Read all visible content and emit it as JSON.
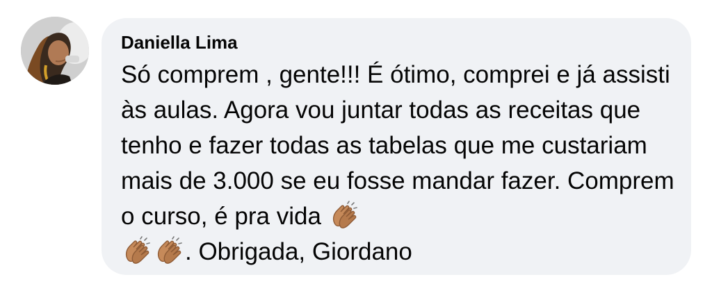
{
  "comment": {
    "author": "Daniella Lima",
    "text_part1": "Só comprem , gente!!! É ótimo, comprei e já assisti às aulas. Agora vou juntar todas as receitas que tenho e fazer todas as tabelas que me custariam mais de 3.000 se eu fosse mandar fazer. Comprem o curso, é pra vida ",
    "text_part2": ". Obrigada, Giordano",
    "emoji_icons": [
      "clapping-hands-icon",
      "clapping-hands-icon",
      "clapping-hands-icon"
    ]
  },
  "colors": {
    "bubble_bg": "#f0f2f5",
    "text": "#050505",
    "emoji_skin": "#c68a5a"
  }
}
